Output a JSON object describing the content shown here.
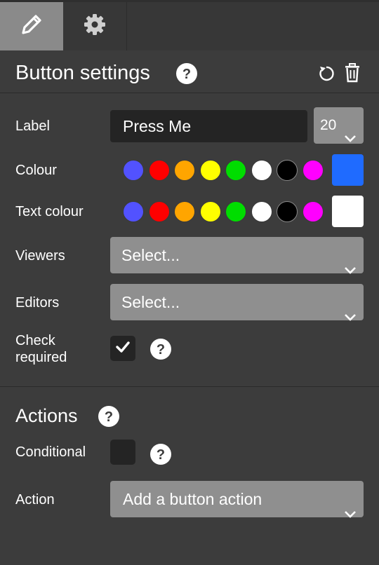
{
  "tabs": [
    {
      "name": "edit",
      "icon": "pencil-icon",
      "active": true
    },
    {
      "name": "settings",
      "icon": "gear-icon",
      "active": false
    }
  ],
  "header": {
    "title": "Button settings",
    "help_icon": "help-icon",
    "reset_icon": "reset-icon",
    "delete_icon": "trash-icon"
  },
  "fields": {
    "label": {
      "label": "Label",
      "value": "Press Me",
      "size": "20"
    },
    "colour": {
      "label": "Colour",
      "options": [
        "#5252ff",
        "#ff0000",
        "#ffa500",
        "#ffff00",
        "#00dd00",
        "#ffffff",
        "#000000",
        "#ff00ff"
      ],
      "selected": "#1f6bff"
    },
    "text_colour": {
      "label": "Text colour",
      "options": [
        "#5252ff",
        "#ff0000",
        "#ffa500",
        "#ffff00",
        "#00dd00",
        "#ffffff",
        "#000000",
        "#ff00ff"
      ],
      "selected": "#ffffff"
    },
    "viewers": {
      "label": "Viewers",
      "placeholder": "Select..."
    },
    "editors": {
      "label": "Editors",
      "placeholder": "Select..."
    },
    "check_required": {
      "label_line1": "Check",
      "label_line2": "required",
      "checked": true
    }
  },
  "actions": {
    "title": "Actions",
    "conditional": {
      "label": "Conditional",
      "checked": false
    },
    "action": {
      "label": "Action",
      "placeholder": "Add a button action"
    }
  }
}
